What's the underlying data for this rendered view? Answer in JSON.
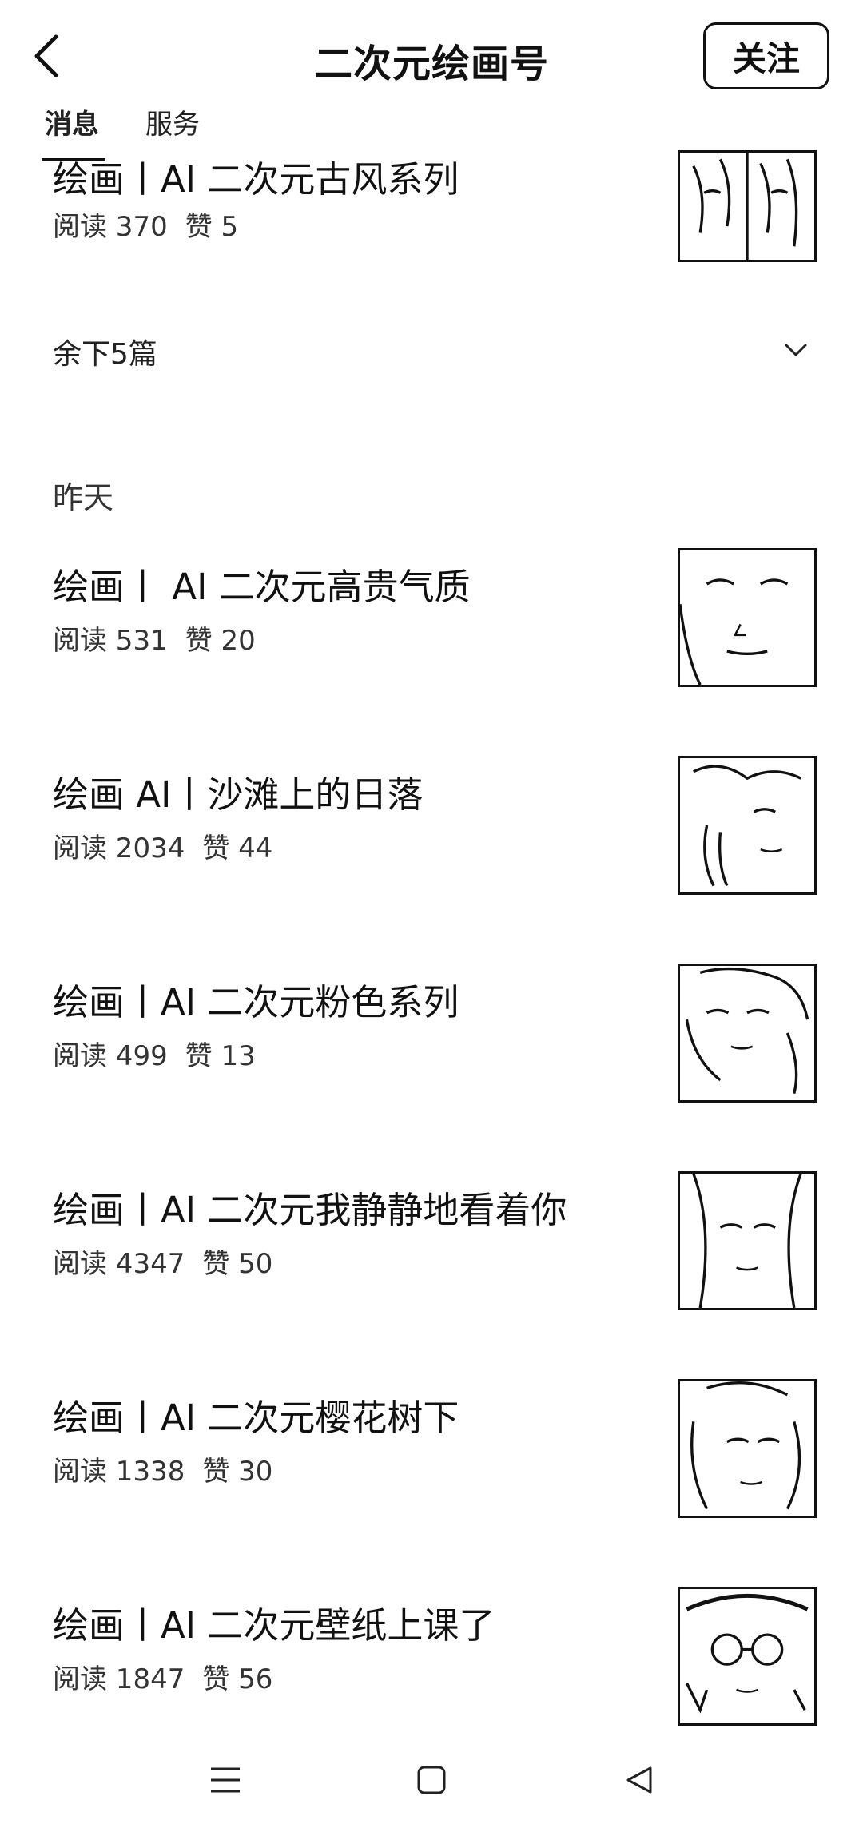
{
  "header": {
    "title": "二次元绘画号",
    "follow_label": "关注"
  },
  "tabs": [
    {
      "label": "消息",
      "active": true
    },
    {
      "label": "服务",
      "active": false
    }
  ],
  "top_article": {
    "title": "绘画丨AI 二次元古风系列",
    "read_label": "阅读 370",
    "like_label": "赞 5"
  },
  "more": {
    "label": "余下5篇"
  },
  "section": {
    "label": "昨天"
  },
  "articles": [
    {
      "title": "绘画丨 AI 二次元高贵气质",
      "read_label": "阅读 531",
      "like_label": "赞 20"
    },
    {
      "title": "绘画 AI丨沙滩上的日落",
      "read_label": "阅读 2034",
      "like_label": "赞 44"
    },
    {
      "title": "绘画丨AI 二次元粉色系列",
      "read_label": "阅读 499",
      "like_label": "赞 13"
    },
    {
      "title": "绘画丨AI 二次元我静静地看着你",
      "read_label": "阅读 4347",
      "like_label": "赞 50"
    },
    {
      "title": "绘画丨AI 二次元樱花树下",
      "read_label": "阅读 1338",
      "like_label": "赞 30"
    },
    {
      "title": "绘画丨AI 二次元壁纸上课了",
      "read_label": "阅读 1847",
      "like_label": "赞 56"
    }
  ],
  "icons": {
    "back": "chevron-left-icon",
    "more": "chevron-down-icon",
    "nav_menu": "menu-icon",
    "nav_home": "square-home-icon",
    "nav_back": "triangle-back-icon"
  }
}
